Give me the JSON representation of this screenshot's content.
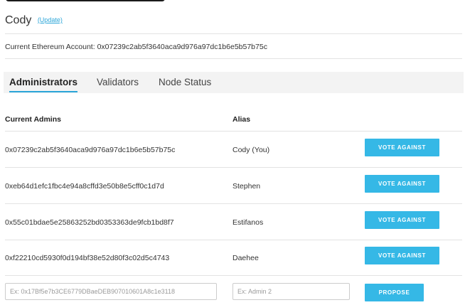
{
  "user": {
    "name": "Cody",
    "update_link": "(Update)"
  },
  "account": {
    "text": "Current Ethereum Account: 0x07239c2ab5f3640aca9d976a97dc1b6e5b57b75c"
  },
  "tabs": [
    {
      "label": "Administrators",
      "active": true
    },
    {
      "label": "Validators",
      "active": false
    },
    {
      "label": "Node Status",
      "active": false
    }
  ],
  "table": {
    "headers": {
      "admin": "Current Admins",
      "alias": "Alias"
    },
    "rows": [
      {
        "address": "0x07239c2ab5f3640aca9d976a97dc1b6e5b57b75c",
        "alias": "Cody (You)",
        "action": "VOTE AGAINST"
      },
      {
        "address": "0xeb64d1efc1fbc4e94a8cffd3e50b8e5cff0c1d7d",
        "alias": "Stephen",
        "action": "VOTE AGAINST"
      },
      {
        "address": "0x55c01bdae5e25863252bd0353363de9fcb1bd8f7",
        "alias": "Estifanos",
        "action": "VOTE AGAINST"
      },
      {
        "address": "0xf22210cd5930f0d194bf38e52d80f3c02d5c4743",
        "alias": "Daehee",
        "action": "VOTE AGAINST"
      }
    ]
  },
  "propose": {
    "address_placeholder": "Ex: 0x17Bf5e7b3CE6779DBaeDEB907010601A8c1e3118",
    "alias_placeholder": "Ex: Admin 2",
    "button_label": "PROPOSE"
  },
  "colors": {
    "accent": "#35b8e6",
    "tab_bg": "#f3f3f3",
    "divider": "#e3e3e3"
  }
}
